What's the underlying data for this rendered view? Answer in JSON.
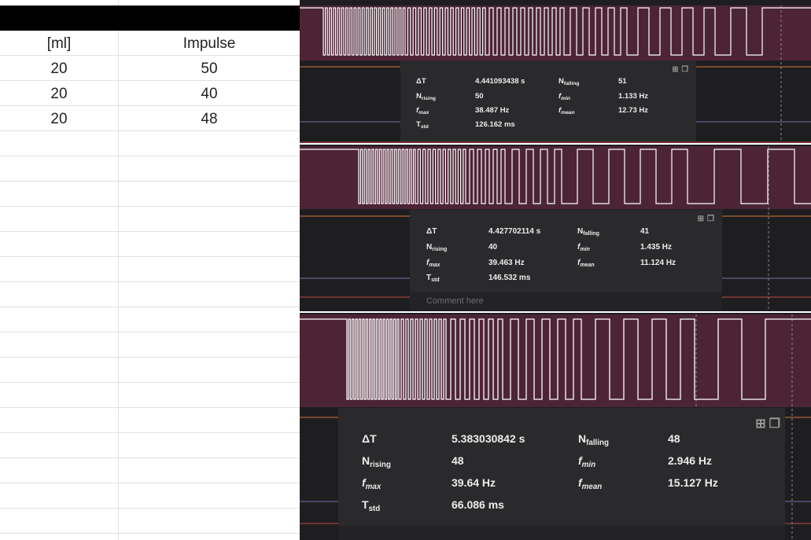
{
  "sheet": {
    "headers": [
      "[ml]",
      "Impulse"
    ],
    "rows": [
      [
        "20",
        "50"
      ],
      [
        "20",
        "40"
      ],
      [
        "20",
        "48"
      ]
    ]
  },
  "panels": [
    {
      "delta_t_label": "ΔT",
      "delta_t": "4.441093438 s",
      "n_falling_label": "N",
      "n_falling_sub": "falling",
      "n_falling": "51",
      "n_rising_label": "N",
      "n_rising_sub": "rising",
      "n_rising": "50",
      "f_min_label": "f",
      "f_min_sub": "min",
      "f_min": "1.133 Hz",
      "f_max_label": "f",
      "f_max_sub": "max",
      "f_max": "38.487 Hz",
      "f_mean_label": "f",
      "f_mean_sub": "mean",
      "f_mean": "12.73 Hz",
      "t_std_label": "T",
      "t_std_sub": "std",
      "t_std": "126.162 ms"
    },
    {
      "delta_t_label": "ΔT",
      "delta_t": "4.427702114 s",
      "n_falling_label": "N",
      "n_falling_sub": "falling",
      "n_falling": "41",
      "n_rising_label": "N",
      "n_rising_sub": "rising",
      "n_rising": "40",
      "f_min_label": "f",
      "f_min_sub": "min",
      "f_min": "1.435 Hz",
      "f_max_label": "f",
      "f_max_sub": "max",
      "f_max": "39.463 Hz",
      "f_mean_label": "f",
      "f_mean_sub": "mean",
      "f_mean": "11.124 Hz",
      "t_std_label": "T",
      "t_std_sub": "std",
      "t_std": "146.532 ms",
      "comment_placeholder": "Comment here"
    },
    {
      "delta_t_label": "ΔT",
      "delta_t": "5.383030842 s",
      "n_falling_label": "N",
      "n_falling_sub": "falling",
      "n_falling": "48",
      "n_rising_label": "N",
      "n_rising_sub": "rising",
      "n_rising": "48",
      "f_min_label": "f",
      "f_min_sub": "min",
      "f_min": "2.946 Hz",
      "f_max_label": "f",
      "f_max_sub": "max",
      "f_max": "39.64 Hz",
      "f_mean_label": "f",
      "f_mean_sub": "mean",
      "f_mean": "15.127 Hz",
      "t_std_label": "T",
      "t_std_sub": "std",
      "t_std": "66.086 ms"
    }
  ],
  "icons": [
    "expand-icon",
    "copy-icon"
  ],
  "colors": {
    "wave_bg": "#4d2436",
    "wave_line": "#ffffff",
    "panel_bg": "#1e1e20",
    "measure_bg": "#2a2a2c",
    "marker_orange": "#d8763a",
    "marker_red": "#c24b4b",
    "marker_purple": "#7a6aa8"
  }
}
